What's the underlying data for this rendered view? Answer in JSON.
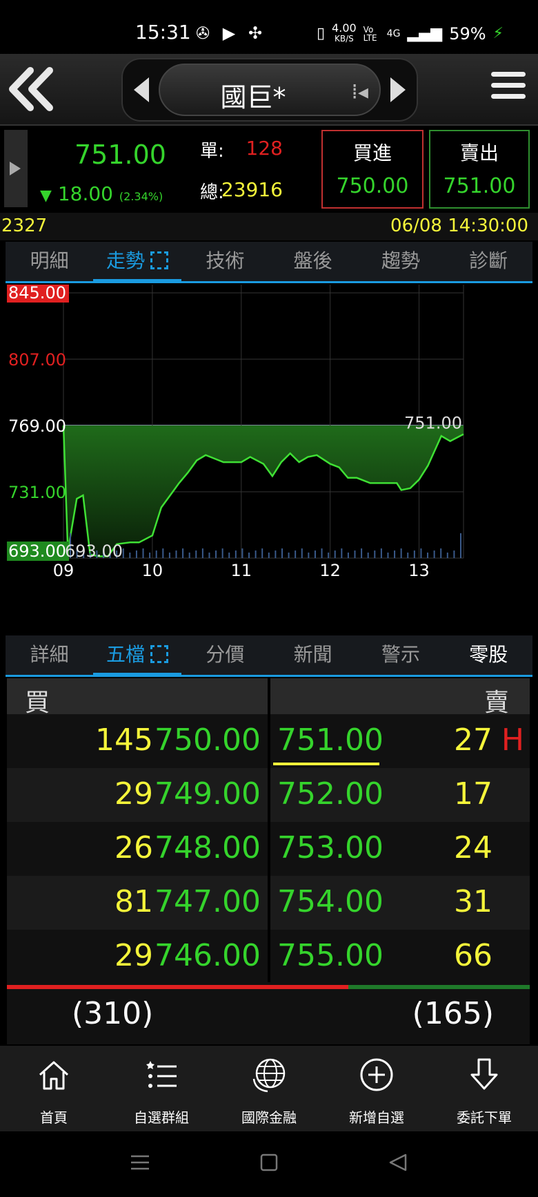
{
  "status_bar": {
    "time": "15:31",
    "net_speed": "4.00",
    "net_unit": "KB/S",
    "volte": "Vo LTE",
    "network": "4G",
    "battery": "59%"
  },
  "header": {
    "stock_name": "國巨*"
  },
  "quote": {
    "last_price": "751.00",
    "change_symbol": "▼",
    "change": "18.00",
    "change_pct": "(2.34%)",
    "unit_label": "單:",
    "unit_volume": "128",
    "total_label": "總:",
    "total_volume": "23916",
    "buy_label": "買進",
    "buy_price": "750.00",
    "sell_label": "賣出",
    "sell_price": "751.00"
  },
  "info": {
    "code": "2327",
    "datetime": "06/08 14:30:00"
  },
  "tabs_top": [
    "明細",
    "走勢",
    "技術",
    "盤後",
    "趨勢",
    "診斷"
  ],
  "tabs_bottom": [
    "詳細",
    "五檔",
    "分價",
    "新聞",
    "警示",
    "零股"
  ],
  "chart_data": {
    "type": "area",
    "y_ticks": [
      "845.00",
      "807.00",
      "769.00",
      "731.00",
      "693.00"
    ],
    "x_ticks": [
      "09",
      "10",
      "11",
      "12",
      "13"
    ],
    "ylim": [
      693,
      845
    ],
    "reference": 769,
    "low_label": "693.00",
    "last_label": "751.00",
    "x_hours": [
      9.0,
      9.05,
      9.15,
      9.22,
      9.3,
      9.4,
      9.5,
      9.6,
      9.75,
      9.85,
      10.0,
      10.1,
      10.2,
      10.3,
      10.4,
      10.5,
      10.6,
      10.8,
      10.9,
      11.0,
      11.1,
      11.25,
      11.35,
      11.45,
      11.55,
      11.65,
      11.75,
      11.85,
      12.0,
      12.1,
      12.2,
      12.3,
      12.45,
      12.6,
      12.75,
      12.8,
      12.9,
      13.0,
      13.1,
      13.25,
      13.35,
      13.5
    ],
    "values": [
      769,
      697,
      727,
      729,
      695,
      694,
      694,
      701,
      702,
      702,
      706,
      722,
      729,
      736,
      742,
      749,
      752,
      748,
      748,
      748,
      751,
      747,
      740,
      748,
      753,
      748,
      751,
      752,
      747,
      745,
      739,
      739,
      736,
      736,
      736,
      732,
      733,
      738,
      746,
      763,
      760,
      764
    ],
    "volume": [
      4,
      2,
      2,
      1,
      1,
      1,
      1,
      2,
      1,
      1,
      1,
      1,
      1,
      1,
      1,
      1,
      1,
      1,
      1,
      1,
      1,
      1,
      1,
      1,
      1,
      1,
      1,
      1,
      1,
      1,
      1,
      1,
      1,
      1,
      1,
      1,
      1,
      1,
      1,
      1,
      1,
      6
    ]
  },
  "order_book": {
    "buy_header": "買",
    "sell_header": "賣",
    "rows": [
      {
        "buy_qty": "145",
        "buy_price": "750.00",
        "sell_price": "751.00",
        "sell_qty": "27"
      },
      {
        "buy_qty": "29",
        "buy_price": "749.00",
        "sell_price": "752.00",
        "sell_qty": "17"
      },
      {
        "buy_qty": "26",
        "buy_price": "748.00",
        "sell_price": "753.00",
        "sell_qty": "24"
      },
      {
        "buy_qty": "81",
        "buy_price": "747.00",
        "sell_price": "754.00",
        "sell_qty": "31"
      },
      {
        "buy_qty": "29",
        "buy_price": "746.00",
        "sell_price": "755.00",
        "sell_qty": "66"
      }
    ],
    "h_mark": "H",
    "buy_total": "(310)",
    "sell_total": "(165)",
    "buy_ratio": 0.6526
  },
  "bottom_nav": [
    "首頁",
    "自選群組",
    "國際金融",
    "新增自選",
    "委託下單"
  ],
  "colors": {
    "up_red": "#e02020",
    "down_green": "#35d42c",
    "volume_yellow": "#f5f53a",
    "accent_blue": "#1a9be0"
  }
}
